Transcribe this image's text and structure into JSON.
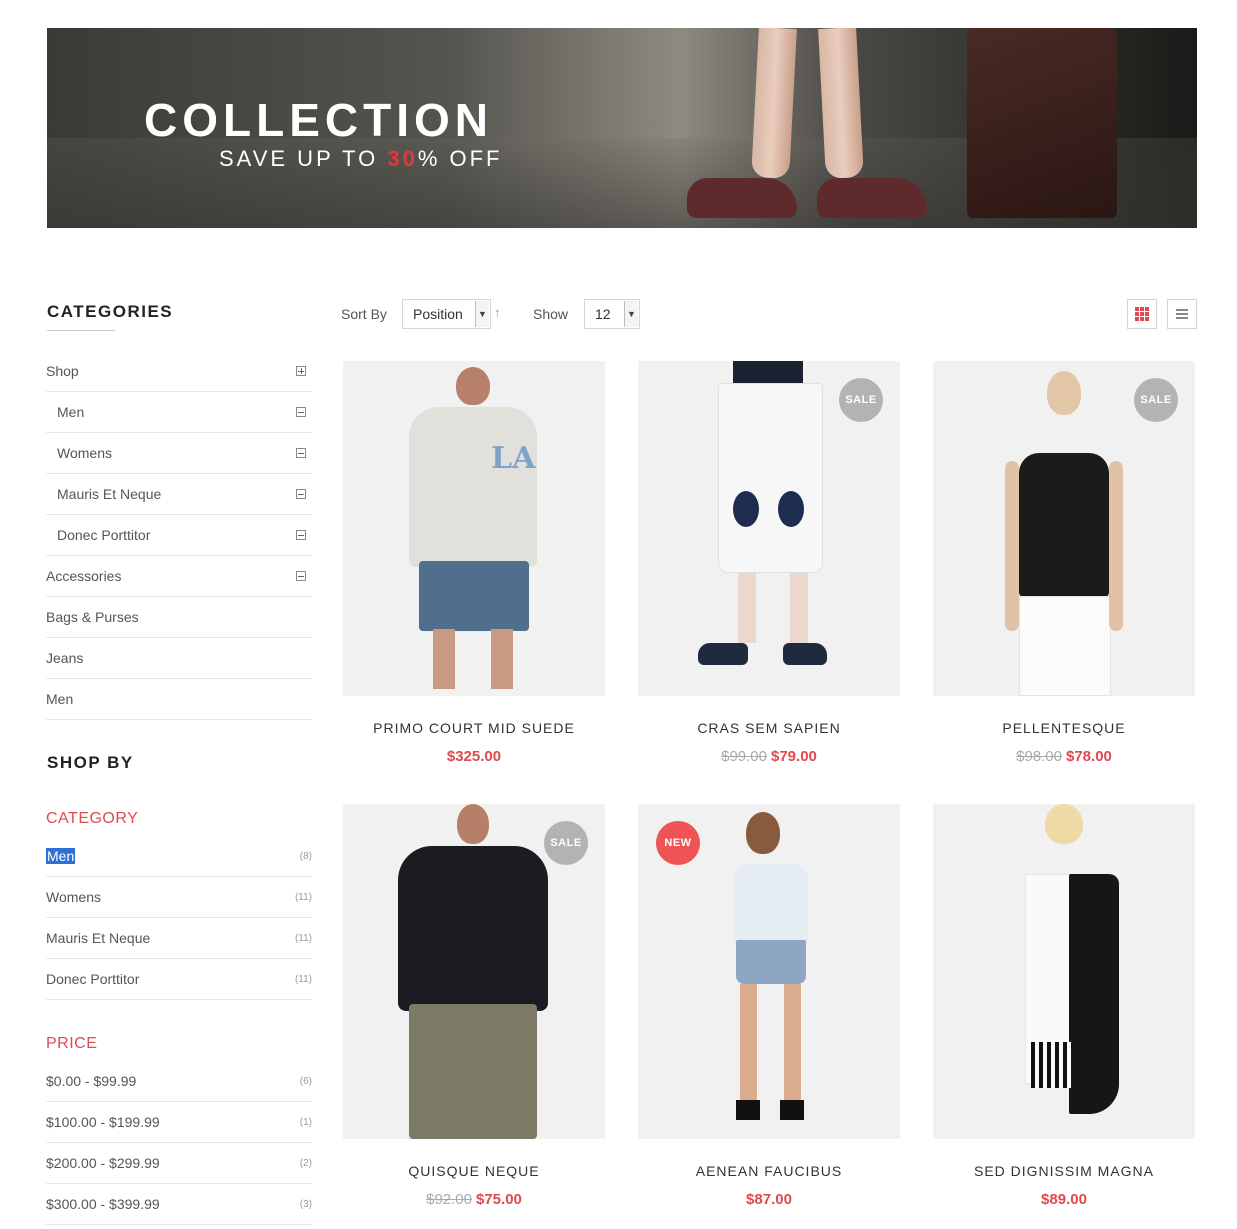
{
  "banner": {
    "title": "COLLECTION",
    "subtitle_pre": "SAVE UP TO ",
    "subtitle_highlight": "30",
    "subtitle_post": "% OFF"
  },
  "sidebar": {
    "categories_title": "CATEGORIES",
    "categories": [
      {
        "label": "Shop",
        "toggle": "expand"
      },
      {
        "label": "Men",
        "toggle": "collapse",
        "sub": true
      },
      {
        "label": "Womens",
        "toggle": "collapse",
        "sub": true
      },
      {
        "label": "Mauris Et Neque",
        "toggle": "collapse",
        "sub": true
      },
      {
        "label": "Donec Porttitor",
        "toggle": "collapse",
        "sub": true
      },
      {
        "label": "Accessories",
        "toggle": "collapse"
      },
      {
        "label": "Bags & Purses"
      },
      {
        "label": "Jeans"
      },
      {
        "label": "Men"
      }
    ],
    "shop_by_title": "SHOP BY",
    "category_filter": {
      "heading": "CATEGORY",
      "items": [
        {
          "label": "Men",
          "count": "(8)"
        },
        {
          "label": "Womens",
          "count": "(11)"
        },
        {
          "label": "Mauris Et Neque",
          "count": "(11)"
        },
        {
          "label": "Donec Porttitor",
          "count": "(11)"
        }
      ]
    },
    "price_filter": {
      "heading": "PRICE",
      "items": [
        {
          "label": "$0.00 - $99.99",
          "count": "(6)"
        },
        {
          "label": "$100.00 - $199.99",
          "count": "(1)"
        },
        {
          "label": "$200.00 - $299.99",
          "count": "(2)"
        },
        {
          "label": "$300.00 - $399.99",
          "count": "(3)"
        }
      ]
    }
  },
  "toolbar": {
    "sort_label": "Sort By",
    "sort_value": "Position",
    "sort_direction_icon": "arrow-up-icon",
    "show_label": "Show",
    "show_value": "12",
    "grid_view_icon": "grid-view-icon",
    "list_view_icon": "list-view-icon",
    "accent_color": "#e04a4f"
  },
  "products": [
    {
      "name": "PRIMO COURT MID SUEDE",
      "old_price": "",
      "price": "$325.00",
      "badge": ""
    },
    {
      "name": "CRAS SEM SAPIEN",
      "old_price": "$99.00",
      "price": "$79.00",
      "badge": "SALE"
    },
    {
      "name": "PELLENTESQUE",
      "old_price": "$98.00",
      "price": "$78.00",
      "badge": "SALE"
    },
    {
      "name": "QUISQUE NEQUE",
      "old_price": "$92.00",
      "price": "$75.00",
      "badge": "SALE"
    },
    {
      "name": "AENEAN FAUCIBUS",
      "old_price": "",
      "price": "$87.00",
      "badge": "NEW"
    },
    {
      "name": "SED DIGNISSIM MAGNA",
      "old_price": "",
      "price": "$89.00",
      "badge": ""
    }
  ]
}
